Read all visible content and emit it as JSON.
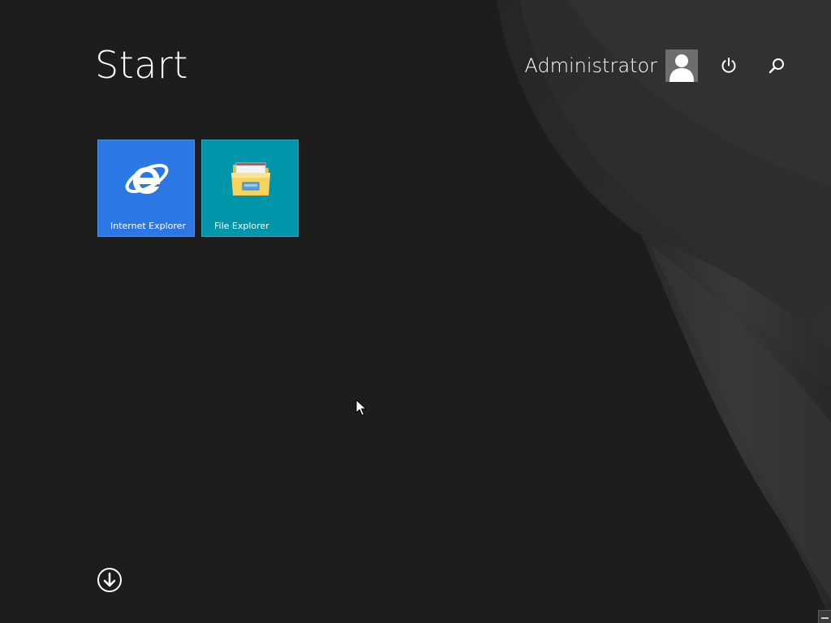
{
  "start": {
    "title": "Start"
  },
  "user": {
    "name": "Administrator",
    "avatar_icon": "user-silhouette-icon"
  },
  "header_icons": {
    "power": "power-icon",
    "search": "search-icon"
  },
  "tiles": [
    {
      "label": "Internet Explorer",
      "icon": "internet-explorer-icon",
      "color": "#2b78e4"
    },
    {
      "label": "File Explorer",
      "icon": "file-explorer-folder-icon",
      "color": "#0096a9"
    }
  ],
  "all_apps": {
    "icon": "arrow-down-circle-icon"
  },
  "colors": {
    "background": "#1d1d1d",
    "accent_swirl": "#3a3a3a"
  }
}
